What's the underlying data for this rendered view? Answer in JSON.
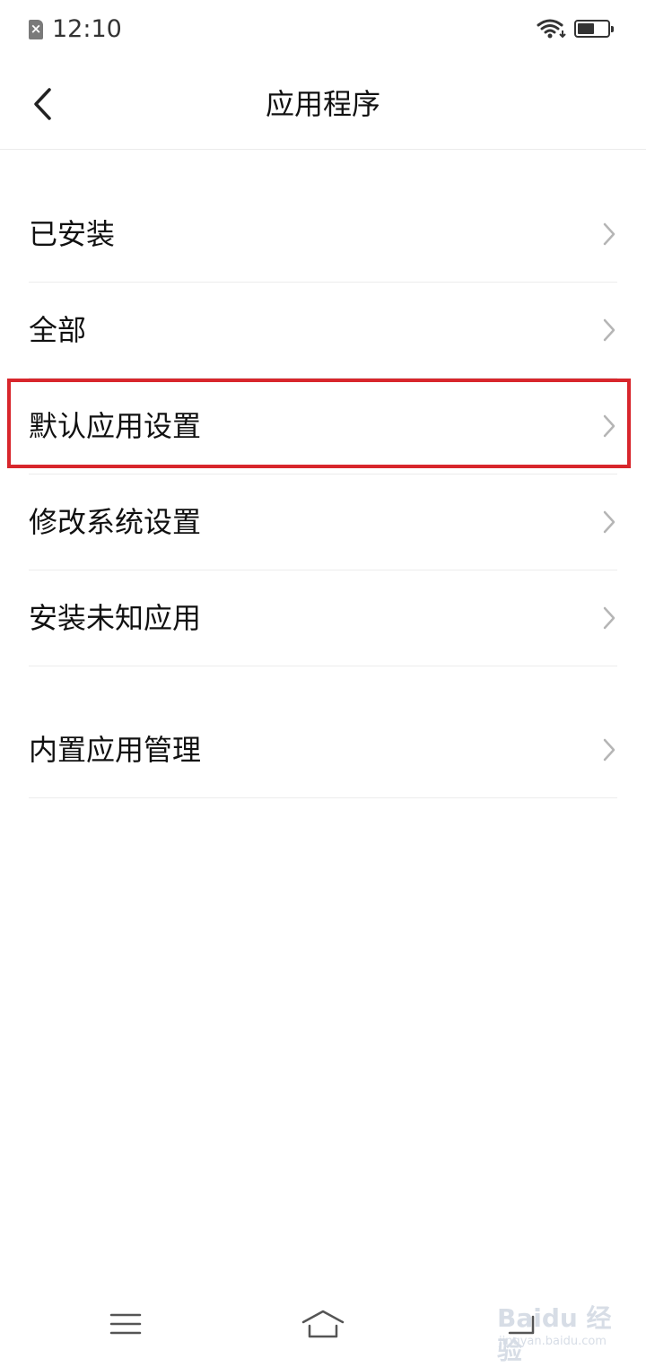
{
  "status_bar": {
    "time": "12:10",
    "sim_icon": "sim-error-icon",
    "wifi_icon": "wifi-icon",
    "battery_icon": "battery-icon",
    "battery_level": 0.55
  },
  "header": {
    "title": "应用程序",
    "back_icon": "chevron-left-icon"
  },
  "list": {
    "items": [
      {
        "label": "已安装",
        "icon": "chevron-right-icon"
      },
      {
        "label": "全部",
        "icon": "chevron-right-icon"
      },
      {
        "label": "默认应用设置",
        "icon": "chevron-right-icon",
        "highlighted": true
      },
      {
        "label": "修改系统设置",
        "icon": "chevron-right-icon"
      },
      {
        "label": "安装未知应用",
        "icon": "chevron-right-icon"
      },
      {
        "label": "内置应用管理",
        "icon": "chevron-right-icon"
      }
    ]
  },
  "nav_bar": {
    "menu_icon": "menu-icon",
    "home_icon": "home-icon",
    "back_icon": "back-icon"
  },
  "watermark": {
    "logo": "Baidu 经验",
    "sub": "jingyan.baidu.com"
  },
  "colors": {
    "highlight": "#d8262c",
    "divider": "#ececec",
    "chevron": "#b5b5b5",
    "text": "#111111"
  }
}
